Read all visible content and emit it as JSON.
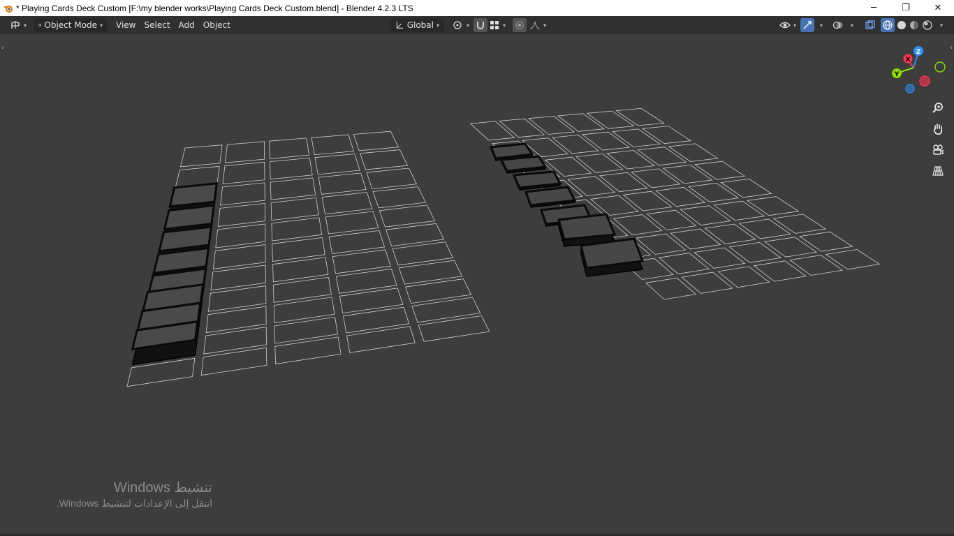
{
  "window": {
    "title": "* Playing Cards Deck Custom [F:\\my blender works\\Playing Cards Deck Custom.blend] - Blender 4.2.3 LTS",
    "minimize": "─",
    "maximize": "❐",
    "close": "✕"
  },
  "header": {
    "mode_label": "Object Mode",
    "menus": [
      "View",
      "Select",
      "Add",
      "Object"
    ],
    "orientation_label": "Global"
  },
  "colors": {
    "viewport_bg": "#3d3d3d",
    "header_bg": "#303030",
    "active_blue": "#4772b3",
    "axis_x": "#ff3352",
    "axis_y": "#8bdc00",
    "axis_z": "#2890ff"
  },
  "gizmo": {
    "z": "Z",
    "x": "X",
    "y": "Y"
  },
  "navigation": [
    "zoom-icon",
    "hand-pan-icon",
    "camera-icon",
    "grid-perspective-icon"
  ],
  "activation": {
    "line1": "تنشيط Windows",
    "line2": "انتقل إلى الإعدادات لتنشيط Windows."
  }
}
